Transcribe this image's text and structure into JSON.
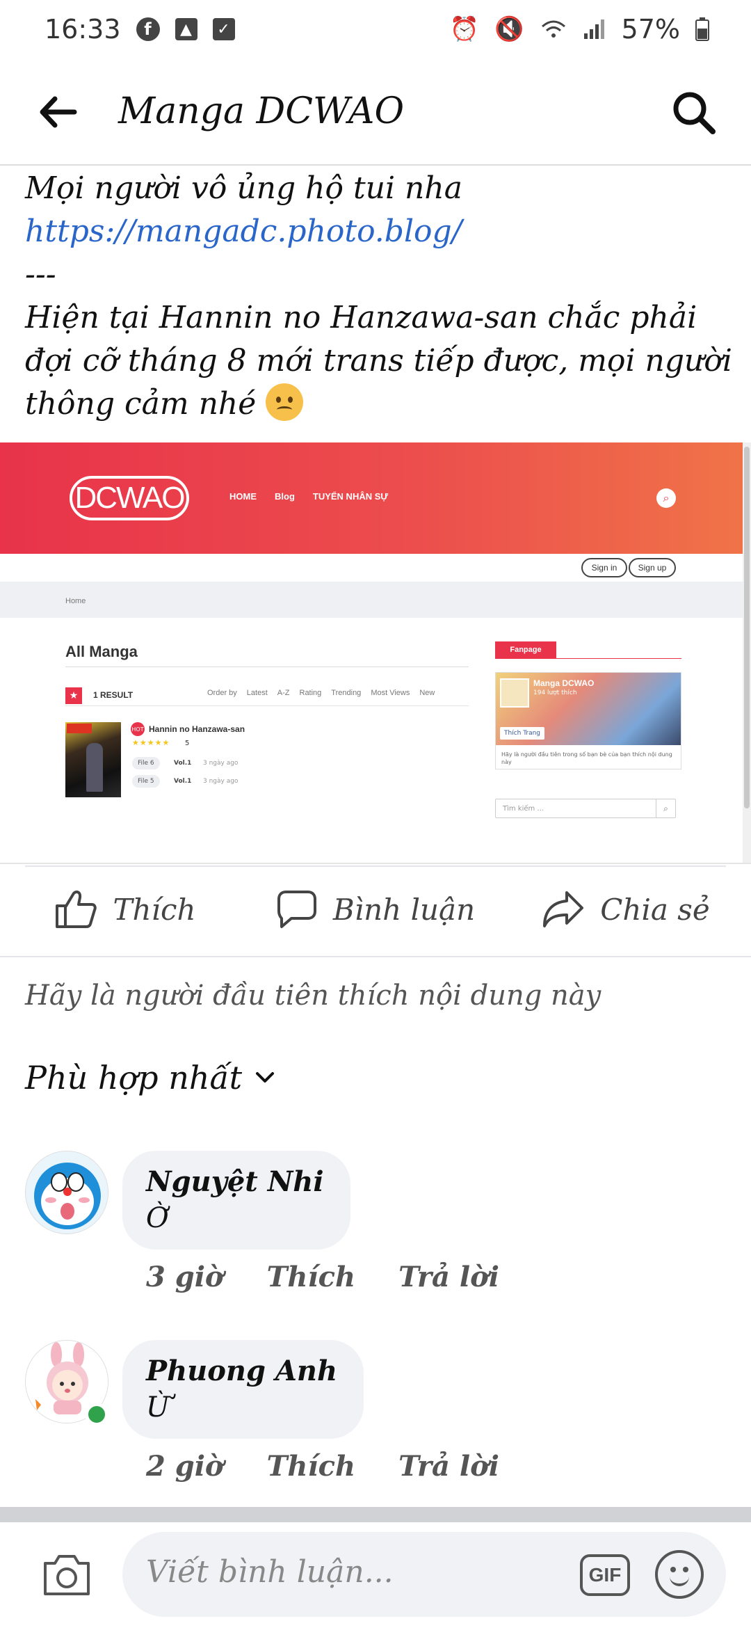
{
  "status_bar": {
    "time": "16:33",
    "battery": "57%",
    "left_icons": [
      "facebook-icon",
      "image-icon",
      "checkbox-icon"
    ],
    "right_icons": [
      "alarm-icon",
      "mute-icon",
      "wifi-icon",
      "signal-icon",
      "battery-icon"
    ]
  },
  "header": {
    "title": "Manga DCWAO",
    "back_icon": "arrow-left-icon",
    "search_icon": "search-icon"
  },
  "post": {
    "line1": "Mọi người vô ủng hộ tui nha",
    "link": "https://mangadc.photo.blog/",
    "separator": "---",
    "line2": "Hiện tại Hannin no Hanzawa-san chắc phải",
    "line3": "đợi cỡ tháng 8 mới trans tiếp được, mọi người",
    "line4": "thông cảm nhé"
  },
  "embed": {
    "logo": "DCWAO",
    "nav": [
      "HOME",
      "Blog",
      "TUYỂN NHÂN SỰ"
    ],
    "sign_in": "Sign in",
    "sign_up": "Sign up",
    "breadcrumb": "Home",
    "section_title": "All Manga",
    "result_count": "1 RESULT",
    "sort_options": [
      "Order by",
      "Latest",
      "A-Z",
      "Rating",
      "Trending",
      "Most Views",
      "New"
    ],
    "manga": {
      "title": "Hannin no Hanzawa-san",
      "hot_label": "HOT",
      "stars": "★★★★★",
      "rating": "5",
      "chapters": [
        {
          "file": "File 6",
          "vol": "Vol.1",
          "time": "3 ngày ago"
        },
        {
          "file": "File 5",
          "vol": "Vol.1",
          "time": "3 ngày ago"
        }
      ]
    },
    "fanpage_tab": "Fanpage",
    "fanpage": {
      "name": "Manga DCWAO",
      "likes": "194 lượt thích",
      "like_button": "Thích Trang",
      "footer": "Hãy là người đầu tiên trong số bạn bè của bạn thích nội dung này"
    },
    "search_placeholder": "Tìm kiếm ..."
  },
  "actions": {
    "like": "Thích",
    "comment": "Bình luận",
    "share": "Chia sẻ"
  },
  "first_like_text": "Hãy là người đầu tiên thích nội dung này",
  "sort_label": "Phù hợp nhất",
  "comments": [
    {
      "name": "Nguyệt Nhi",
      "text": "Ờ",
      "time": "3 giờ",
      "like": "Thích",
      "reply": "Trả lời"
    },
    {
      "name": "Phuong Anh",
      "text": "Ừ",
      "time": "2 giờ",
      "like": "Thích",
      "reply": "Trả lời"
    }
  ],
  "composer": {
    "placeholder": "Viết bình luận...",
    "gif": "GIF"
  },
  "colors": {
    "link": "#2a66c9",
    "site_brand": "#e8334a",
    "online": "#31a24c"
  }
}
